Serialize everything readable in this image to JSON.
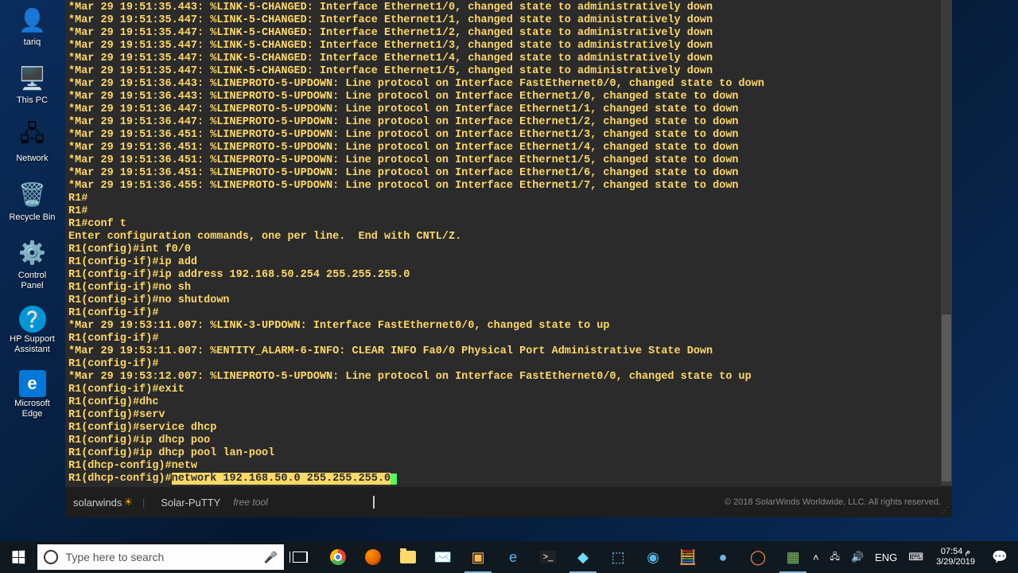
{
  "desktop": {
    "icons": [
      {
        "label": "tariq",
        "glyph": "👤"
      },
      {
        "label": "This PC",
        "glyph": "🖥️"
      },
      {
        "label": "Network",
        "glyph": "🖧"
      },
      {
        "label": "Recycle Bin",
        "glyph": "🗑️"
      },
      {
        "label": "Control Panel",
        "glyph": "⚙️"
      },
      {
        "label": "HP Support Assistant",
        "glyph": "❔"
      },
      {
        "label": "Microsoft Edge",
        "glyph": "e"
      }
    ]
  },
  "terminal": {
    "lines": [
      "*Mar 29 19:51:35.443: %LINK-5-CHANGED: Interface Ethernet1/0, changed state to administratively down",
      "*Mar 29 19:51:35.447: %LINK-5-CHANGED: Interface Ethernet1/1, changed state to administratively down",
      "*Mar 29 19:51:35.447: %LINK-5-CHANGED: Interface Ethernet1/2, changed state to administratively down",
      "*Mar 29 19:51:35.447: %LINK-5-CHANGED: Interface Ethernet1/3, changed state to administratively down",
      "*Mar 29 19:51:35.447: %LINK-5-CHANGED: Interface Ethernet1/4, changed state to administratively down",
      "*Mar 29 19:51:35.447: %LINK-5-CHANGED: Interface Ethernet1/5, changed state to administratively down",
      "*Mar 29 19:51:36.443: %LINEPROTO-5-UPDOWN: Line protocol on Interface FastEthernet0/0, changed state to down",
      "*Mar 29 19:51:36.443: %LINEPROTO-5-UPDOWN: Line protocol on Interface Ethernet1/0, changed state to down",
      "*Mar 29 19:51:36.447: %LINEPROTO-5-UPDOWN: Line protocol on Interface Ethernet1/1, changed state to down",
      "*Mar 29 19:51:36.447: %LINEPROTO-5-UPDOWN: Line protocol on Interface Ethernet1/2, changed state to down",
      "*Mar 29 19:51:36.451: %LINEPROTO-5-UPDOWN: Line protocol on Interface Ethernet1/3, changed state to down",
      "*Mar 29 19:51:36.451: %LINEPROTO-5-UPDOWN: Line protocol on Interface Ethernet1/4, changed state to down",
      "*Mar 29 19:51:36.451: %LINEPROTO-5-UPDOWN: Line protocol on Interface Ethernet1/5, changed state to down",
      "*Mar 29 19:51:36.451: %LINEPROTO-5-UPDOWN: Line protocol on Interface Ethernet1/6, changed state to down",
      "*Mar 29 19:51:36.455: %LINEPROTO-5-UPDOWN: Line protocol on Interface Ethernet1/7, changed state to down",
      "R1#",
      "R1#",
      "R1#conf t",
      "Enter configuration commands, one per line.  End with CNTL/Z.",
      "R1(config)#int f0/0",
      "R1(config-if)#ip add",
      "R1(config-if)#ip address 192.168.50.254 255.255.255.0",
      "R1(config-if)#no sh",
      "R1(config-if)#no shutdown",
      "R1(config-if)#",
      "*Mar 29 19:53:11.007: %LINK-3-UPDOWN: Interface FastEthernet0/0, changed state to up",
      "R1(config-if)#",
      "*Mar 29 19:53:11.007: %ENTITY_ALARM-6-INFO: CLEAR INFO Fa0/0 Physical Port Administrative State Down",
      "R1(config-if)#",
      "*Mar 29 19:53:12.007: %LINEPROTO-5-UPDOWN: Line protocol on Interface FastEthernet0/0, changed state to up",
      "R1(config-if)#exit",
      "R1(config)#dhc",
      "R1(config)#serv",
      "R1(config)#service dhcp",
      "R1(config)#ip dhcp poo",
      "R1(config)#ip dhcp pool lan-pool",
      "R1(dhcp-config)#netw"
    ],
    "last_prompt": "R1(dhcp-config)#",
    "last_highlight": "network 192.168.50.0 255.255.255.0"
  },
  "footer": {
    "brand": "solarwinds",
    "product": "Solar-PuTTY",
    "tag": "free tool",
    "copyright": "© 2018 SolarWinds Worldwide, LLC. All rights reserved."
  },
  "taskbar": {
    "search_placeholder": "Type here to search",
    "lang": "ENG",
    "time": "07:54 م",
    "date": "3/29/2019"
  }
}
